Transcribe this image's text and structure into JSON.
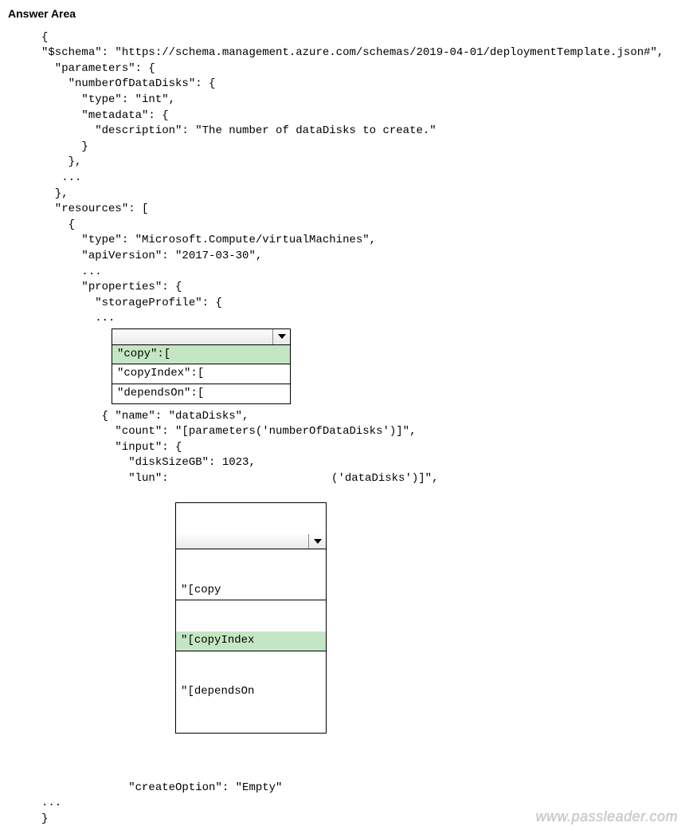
{
  "heading": "Answer Area",
  "code1": "     {\n     \"$schema\": \"https://schema.management.azure.com/schemas/2019-04-01/deploymentTemplate.json#\",\n       \"parameters\": {\n         \"numberOfDataDisks\": {\n           \"type\": \"int\",\n           \"metadata\": {\n             \"description\": \"The number of dataDisks to create.\"\n           }\n         },\n        ...\n       },\n       \"resources\": [\n         {\n           \"type\": \"Microsoft.Compute/virtualMachines\",\n           \"apiVersion\": \"2017-03-30\",\n           ...\n           \"properties\": {\n             \"storageProfile\": {\n             ...",
  "dropdown1": {
    "options": [
      {
        "label": "\"copy\":[",
        "selected": true
      },
      {
        "label": "\"copyIndex\":[",
        "selected": false
      },
      {
        "label": "\"dependsOn\":[",
        "selected": false
      }
    ]
  },
  "code2": "              { \"name\": \"dataDisks\",\n                \"count\": \"[parameters('numberOfDataDisks')]\",\n                \"input\": {\n                  \"diskSizeGB\": 1023,",
  "lun_prefix": "                  \"lun\": ",
  "dropdown2": {
    "options": [
      {
        "label": "\"[copy",
        "selected": false
      },
      {
        "label": "\"[copyIndex",
        "selected": true
      },
      {
        "label": "\"[dependsOn",
        "selected": false
      }
    ]
  },
  "lun_suffix": "('dataDisks')]\",",
  "code3": "\n                  \"createOption\": \"Empty\"\n     ...\n     }",
  "watermark": "www.passleader.com"
}
